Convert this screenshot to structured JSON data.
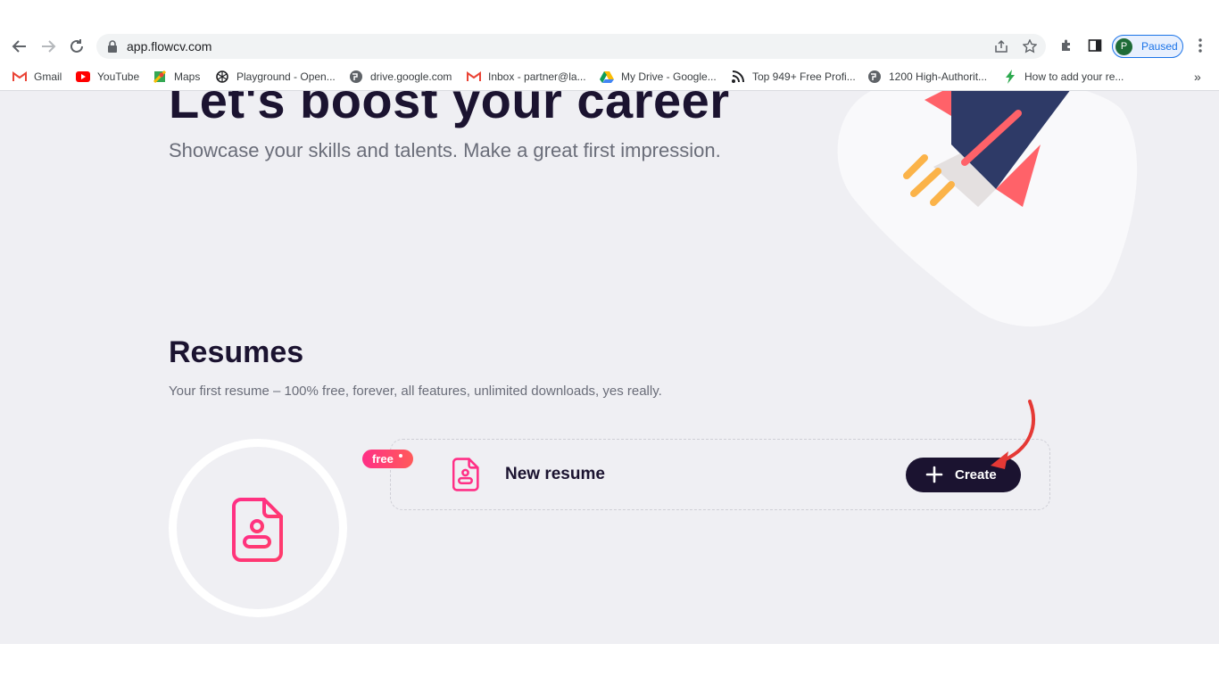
{
  "browser": {
    "url": "app.flowcv.com",
    "profile_initial": "P",
    "profile_status": "Paused",
    "bookmarks": [
      {
        "label": "Gmail",
        "icon": "gmail-icon"
      },
      {
        "label": "YouTube",
        "icon": "youtube-icon"
      },
      {
        "label": "Maps",
        "icon": "maps-icon"
      },
      {
        "label": "Playground - Open...",
        "icon": "openai-icon"
      },
      {
        "label": "drive.google.com",
        "icon": "globe-icon"
      },
      {
        "label": "Inbox - partner@la...",
        "icon": "gmail-icon"
      },
      {
        "label": "My Drive - Google...",
        "icon": "drive-icon"
      },
      {
        "label": "Top 949+ Free Profi...",
        "icon": "feed-icon"
      },
      {
        "label": "1200 High-Authorit...",
        "icon": "globe-icon"
      },
      {
        "label": "How to add your re...",
        "icon": "bolt-icon"
      }
    ],
    "more_bookmarks": "»"
  },
  "hero": {
    "title": "Let's boost your career",
    "subtitle": "Showcase your skills and talents. Make a great first impression."
  },
  "resumes": {
    "title": "Resumes",
    "subtitle": "Your first resume – 100% free, forever, all features, unlimited downloads, yes really.",
    "badge": "free",
    "card_title": "New resume",
    "create_label": "Create"
  },
  "colors": {
    "accent_pink": "#ff2f86",
    "dark": "#1b1330",
    "background": "#efeff3"
  }
}
